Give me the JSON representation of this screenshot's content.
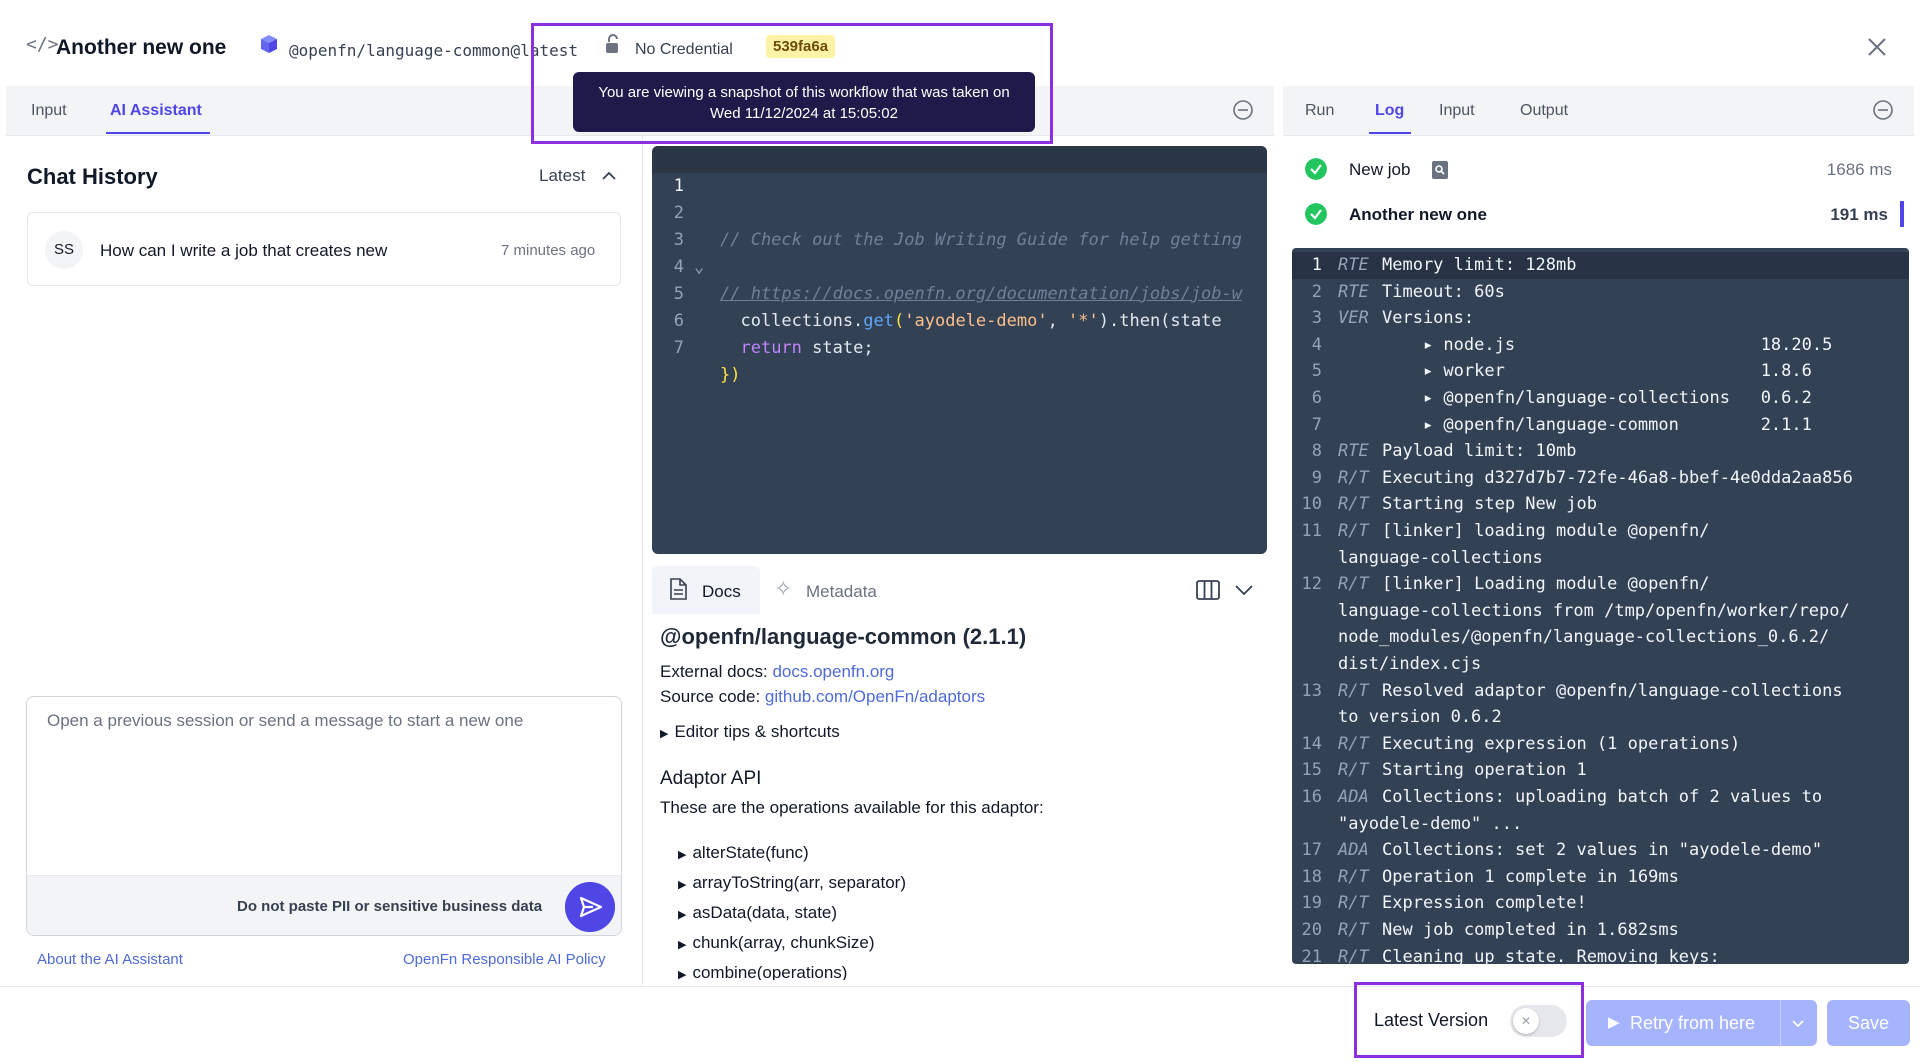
{
  "header": {
    "title": "Another new one",
    "adaptor": "@openfn/language-common@latest",
    "credential": "No Credential",
    "version_sha": "539fa6a",
    "snapshot_tooltip": "You are viewing a snapshot of this workflow that was taken on Wed 11/12/2024 at 15:05:02"
  },
  "left_tabs": [
    {
      "label": "Input",
      "active": false
    },
    {
      "label": "AI Assistant",
      "active": true
    }
  ],
  "chat": {
    "title": "Chat History",
    "sort_label": "Latest",
    "sessions": [
      {
        "initials": "SS",
        "title": "How can I write a job that creates new",
        "time": "7 minutes ago"
      }
    ],
    "placeholder": "Open a previous session or send a message to start a new one",
    "pii_warning": "Do not paste PII or sensitive business data",
    "about_link": "About the AI Assistant",
    "policy_link": "OpenFn Responsible AI Policy"
  },
  "editor": {
    "lines": [
      {
        "n": "1",
        "code": ""
      },
      {
        "n": "2",
        "code": "// Check out the Job Writing Guide for help getting"
      },
      {
        "n": "3",
        "code": "// https://docs.openfn.org/documentation/jobs/job-w"
      },
      {
        "n": "4",
        "code": ""
      },
      {
        "n": "5",
        "pre": "  collections.",
        "fn": "get",
        "open": "(",
        "s1": "'ayodele-demo'",
        "mid": ", ",
        "s2": "'*'",
        "post": ").then(state"
      },
      {
        "n": "6",
        "kw": "return",
        "post": " state;"
      },
      {
        "n": "7",
        "close": "})"
      }
    ]
  },
  "docs": {
    "tabs": [
      {
        "label": "Docs",
        "active": true
      },
      {
        "label": "Metadata",
        "active": false
      }
    ],
    "heading": "@openfn/language-common (2.1.1)",
    "external_label": "External docs:",
    "external_link": "docs.openfn.org",
    "source_label": "Source code:",
    "source_link": "github.com/OpenFn/adaptors",
    "tips": "Editor tips & shortcuts",
    "api_title": "Adaptor API",
    "api_desc": "These are the operations available for this adaptor:",
    "api_items": [
      "alterState(func)",
      "arrayToString(arr, separator)",
      "asData(data, state)",
      "chunk(array, chunkSize)",
      "combine(operations)"
    ]
  },
  "right_tabs": [
    {
      "label": "Run",
      "active": false
    },
    {
      "label": "Log",
      "active": true
    },
    {
      "label": "Input",
      "active": false
    },
    {
      "label": "Output",
      "active": false
    }
  ],
  "steps": [
    {
      "name": "New job",
      "time": "1686 ms",
      "bold": false
    },
    {
      "name": "Another new one",
      "time": "191 ms",
      "bold": true
    }
  ],
  "log": [
    {
      "n": "1",
      "src": "RTE",
      "msg": "Memory limit: 128mb"
    },
    {
      "n": "2",
      "src": "RTE",
      "msg": "Timeout: 60s"
    },
    {
      "n": "3",
      "src": "VER",
      "msg": "Versions:"
    },
    {
      "n": "4",
      "src": "",
      "msg": "    ▸ node.js                        18.20.5"
    },
    {
      "n": "5",
      "src": "",
      "msg": "    ▸ worker                         1.8.6"
    },
    {
      "n": "6",
      "src": "",
      "msg": "    ▸ @openfn/language-collections   0.6.2"
    },
    {
      "n": "7",
      "src": "",
      "msg": "    ▸ @openfn/language-common        2.1.1"
    },
    {
      "n": "8",
      "src": "RTE",
      "msg": "Payload limit: 10mb"
    },
    {
      "n": "9",
      "src": "R/T",
      "msg": "Executing d327d7b7-72fe-46a8-bbef-4e0dda2aa856"
    },
    {
      "n": "10",
      "src": "R/T",
      "msg": "Starting step New job"
    },
    {
      "n": "11",
      "src": "R/T",
      "msg": "[linker] loading module @openfn/"
    },
    {
      "n": "",
      "src": "",
      "msg": "",
      "cont": "language-collections"
    },
    {
      "n": "12",
      "src": "R/T",
      "msg": "[linker] Loading module @openfn/"
    },
    {
      "n": "",
      "src": "",
      "msg": "",
      "cont": "language-collections from /tmp/openfn/worker/repo/"
    },
    {
      "n": "",
      "src": "",
      "msg": "",
      "cont": "node_modules/@openfn/language-collections_0.6.2/"
    },
    {
      "n": "",
      "src": "",
      "msg": "",
      "cont": "dist/index.cjs"
    },
    {
      "n": "13",
      "src": "R/T",
      "msg": "Resolved adaptor @openfn/language-collections"
    },
    {
      "n": "",
      "src": "",
      "msg": "",
      "cont": "to version 0.6.2"
    },
    {
      "n": "14",
      "src": "R/T",
      "msg": "Executing expression (1 operations)"
    },
    {
      "n": "15",
      "src": "R/T",
      "msg": "Starting operation 1"
    },
    {
      "n": "16",
      "src": "ADA",
      "msg": "Collections: uploading batch of 2 values to"
    },
    {
      "n": "",
      "src": "",
      "msg": "",
      "cont": "\"ayodele-demo\" ..."
    },
    {
      "n": "17",
      "src": "ADA",
      "msg": "Collections: set 2 values in \"ayodele-demo\""
    },
    {
      "n": "18",
      "src": "R/T",
      "msg": "Operation 1 complete in 169ms"
    },
    {
      "n": "19",
      "src": "R/T",
      "msg": "Expression complete!"
    },
    {
      "n": "20",
      "src": "R/T",
      "msg": "New job completed in 1.682sms"
    },
    {
      "n": "21",
      "src": "R/T",
      "msg": "Cleaning up state. Removing keys:"
    }
  ],
  "footer": {
    "latest_label": "Latest Version",
    "toggle_on": false,
    "retry_label": "Retry from here",
    "save_label": "Save"
  },
  "colors": {
    "accent": "#4f46e5",
    "highlight": "#8b2fe0",
    "success": "#22c55e",
    "code_bg": "#334155"
  }
}
